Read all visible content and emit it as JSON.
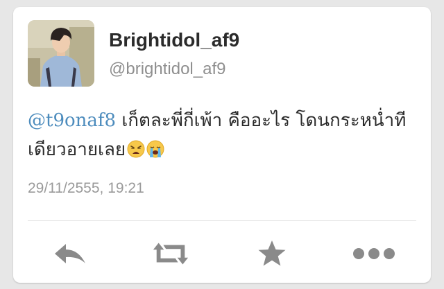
{
  "tweet": {
    "display_name": "Brightidol_af9",
    "handle": "@brightidol_af9",
    "mention": "@t9onaf8",
    "text": " เก็ตละพี่กี่เพ้า คืออะไร โดนกระหน่ำทีเดียวอายเลย",
    "emojis": [
      "weary-face",
      "loudly-crying-face"
    ],
    "timestamp": "29/11/2555, 19:21"
  },
  "actions": [
    {
      "name": "reply",
      "icon": "reply-arrow"
    },
    {
      "name": "retweet",
      "icon": "retweet-arrows"
    },
    {
      "name": "favorite",
      "icon": "star"
    },
    {
      "name": "more",
      "icon": "ellipsis"
    }
  ],
  "colors": {
    "background": "#e7e7e7",
    "card": "#ffffff",
    "name": "#2b2b2b",
    "handle": "#8f8f8f",
    "mention": "#4d8cbd",
    "icon": "#8a8a8a"
  }
}
